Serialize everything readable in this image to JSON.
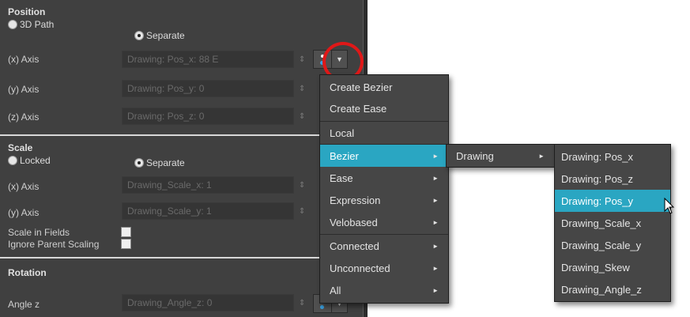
{
  "position": {
    "title": "Position",
    "opt_path": "3D Path",
    "opt_separate": "Separate",
    "x_label": "(x) Axis",
    "x_value": "Drawing: Pos_x: 88 E",
    "y_label": "(y) Axis",
    "y_value": "Drawing: Pos_y: 0",
    "z_label": "(z) Axis",
    "z_value": "Drawing: Pos_z: 0"
  },
  "scale": {
    "title": "Scale",
    "opt_locked": "Locked",
    "opt_separate": "Separate",
    "x_label": "(x) Axis",
    "x_value": "Drawing_Scale_x: 1",
    "y_label": "(y) Axis",
    "y_value": "Drawing_Scale_y: 1",
    "scale_in_fields": "Scale in Fields",
    "ignore_parent": "Ignore Parent Scaling"
  },
  "rotation": {
    "title": "Rotation",
    "angle_label": "Angle z",
    "angle_value": "Drawing_Angle_z: 0"
  },
  "spinner_glyph": "⇕",
  "dropdown_glyph": "▼",
  "menu_arrow": "►",
  "context_menu": {
    "items": [
      "Create Bezier",
      "Create Ease",
      "Local",
      "Bezier",
      "Ease",
      "Expression",
      "Velobased",
      "Connected",
      "Unconnected",
      "All"
    ],
    "active": "Bezier"
  },
  "submenu": {
    "items": [
      "Drawing"
    ]
  },
  "submenu2": {
    "items": [
      "Drawing: Pos_x",
      "Drawing: Pos_z",
      "Drawing: Pos_y",
      "Drawing_Scale_x",
      "Drawing_Scale_y",
      "Drawing_Skew",
      "Drawing_Angle_z"
    ],
    "active": "Drawing: Pos_y"
  },
  "colors": {
    "panel_bg": "#404040",
    "menu_bg": "#464646",
    "highlight": "#2aa6c2",
    "annotation_circle": "#e01818"
  }
}
